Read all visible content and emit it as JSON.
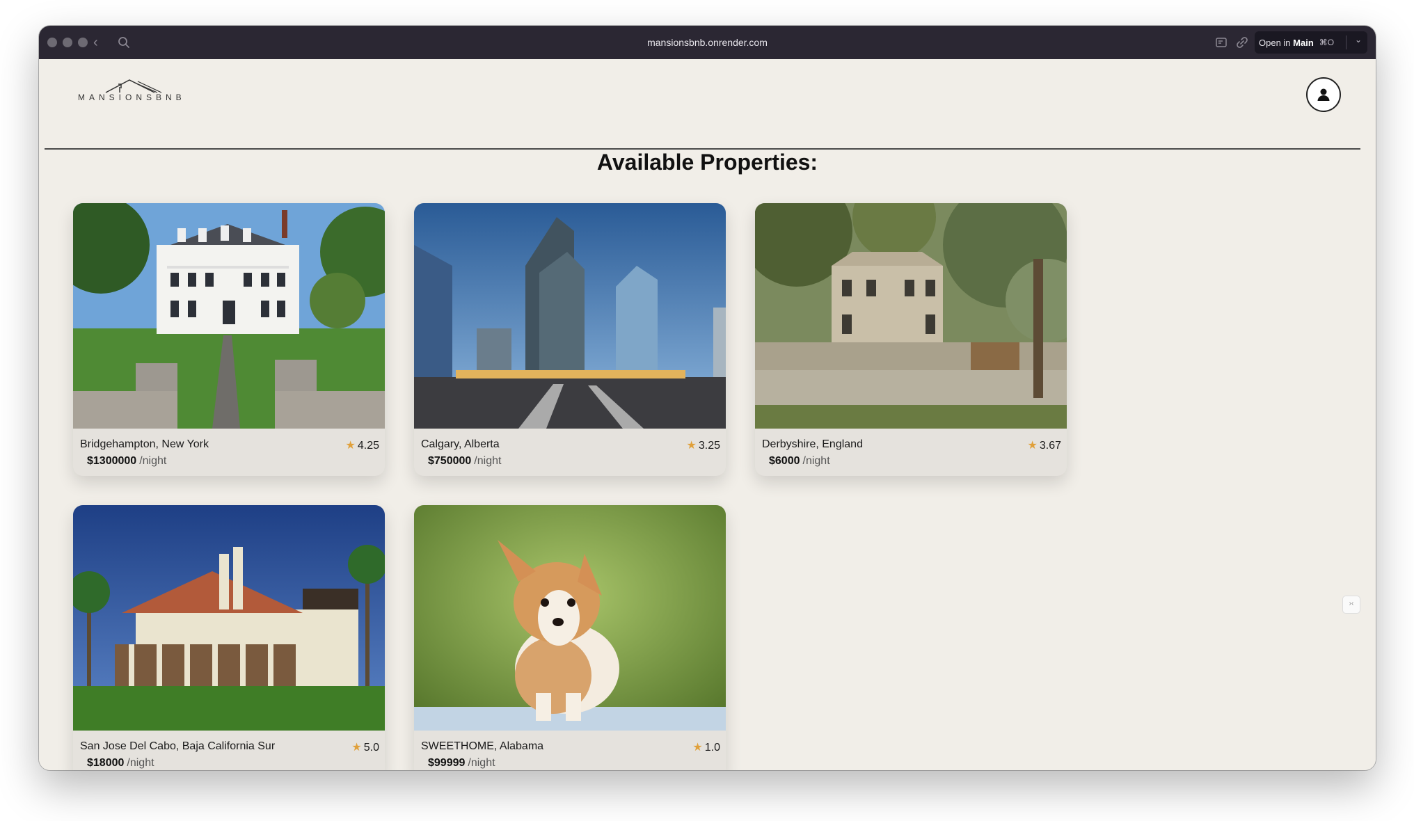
{
  "browser": {
    "url": "mansionsbnb.onrender.com",
    "open_in_label": "Open in",
    "open_in_target": "Main",
    "open_in_shortcut": "⌘O"
  },
  "header": {
    "logo_text": "MANSIONSBNB"
  },
  "main": {
    "title": "Available Properties:",
    "properties": [
      {
        "location": "Bridgehampton, New York",
        "rating": "4.25",
        "price": "$1300000",
        "unit": "/night",
        "image": "white-colonial-mansion"
      },
      {
        "location": "Calgary, Alberta",
        "rating": "3.25",
        "price": "$750000",
        "unit": "/night",
        "image": "city-skyscrapers"
      },
      {
        "location": "Derbyshire, England",
        "rating": "3.67",
        "price": "$6000",
        "unit": "/night",
        "image": "stone-manor-with-garden"
      },
      {
        "location": "San Jose Del Cabo, Baja California Sur",
        "rating": "5.0",
        "price": "$18000",
        "unit": "/night",
        "image": "spanish-villa-palm-trees"
      },
      {
        "location": "SWEETHOME, Alabama",
        "rating": "1.0",
        "price": "$99999",
        "unit": "/night",
        "image": "corgi-puppy"
      }
    ]
  },
  "colors": {
    "page_background": "#f1eee8",
    "card_background": "#e5e2dd",
    "star": "#e0a03a",
    "toolbar": "#2b2733"
  }
}
